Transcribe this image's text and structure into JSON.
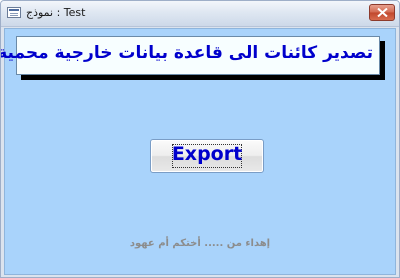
{
  "window": {
    "title": "نموذج : Test"
  },
  "banner": {
    "text": "تصدير كائنات الى قاعدة بيانات خارجية محمية"
  },
  "buttons": {
    "export_label": "Export"
  },
  "footer": {
    "dedication": "إهداء من ..... أختكم أم عهود"
  },
  "colors": {
    "background": "#a9d3fb",
    "banner_text": "#0000cc",
    "button_text": "#0000cc",
    "footer_text": "#8c8c8c"
  },
  "icons": {
    "window_icon": "form-icon",
    "close": "close-icon"
  }
}
